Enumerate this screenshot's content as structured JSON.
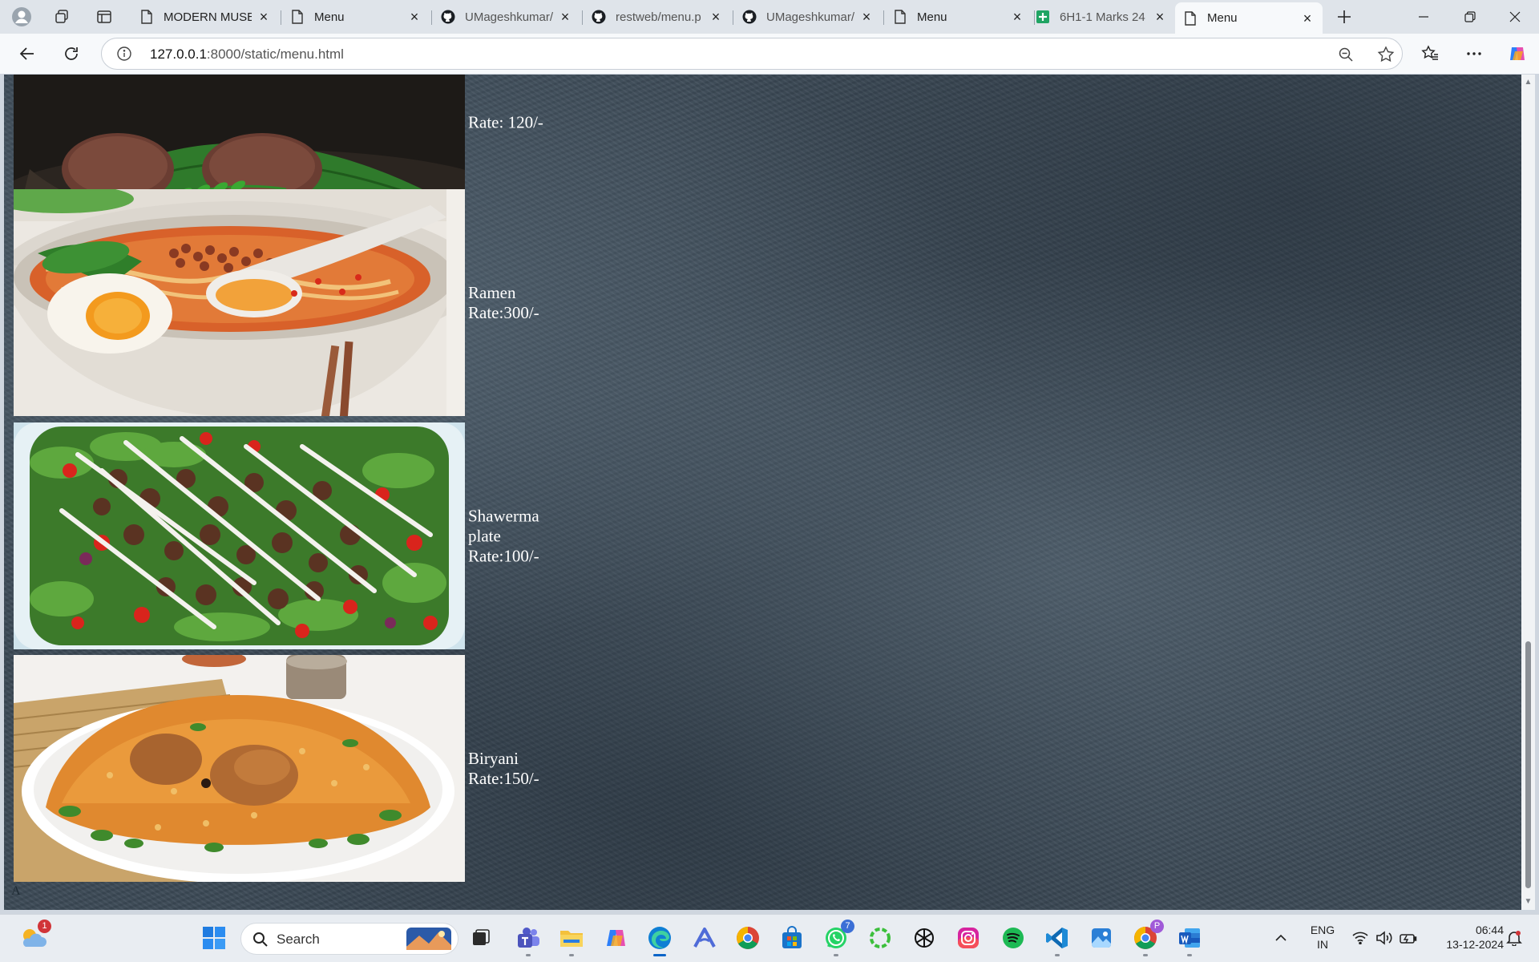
{
  "browser": {
    "tabs": [
      {
        "title": "MODERN MUSE",
        "icon": "page-icon",
        "active": false
      },
      {
        "title": "Menu",
        "icon": "page-icon",
        "active": false
      },
      {
        "title": "UMageshkumar/",
        "icon": "github-icon",
        "active": false
      },
      {
        "title": "restweb/menu.p",
        "icon": "github-icon",
        "active": false
      },
      {
        "title": "UMageshkumar/",
        "icon": "github-icon",
        "active": false
      },
      {
        "title": "Menu",
        "icon": "page-icon",
        "active": false
      },
      {
        "title": "6H1-1 Marks 24",
        "icon": "sheets-icon",
        "active": false
      },
      {
        "title": "Menu",
        "icon": "page-icon",
        "active": true
      }
    ],
    "address": {
      "host": "127.0.0.1",
      "path": ":8000/static/menu.html"
    }
  },
  "page": {
    "items": [
      {
        "name": "",
        "rate": "Rate: 120/-",
        "image": "kebab-patties-on-banana-leaf"
      },
      {
        "name": "Ramen",
        "rate": "Rate:300/-",
        "image": "ramen-bowl-with-egg"
      },
      {
        "name": "Shawerma plate",
        "rate": "Rate:100/-",
        "image": "shawarma-salad-plate"
      },
      {
        "name": "Biryani",
        "rate": "Rate:150/-",
        "image": "chicken-biryani-plate"
      }
    ],
    "corner_text": "A",
    "background_color": "#3c4a56"
  },
  "taskbar": {
    "search_label": "Search",
    "weather_badge": "1",
    "whatsapp_badge": "7",
    "chrome_profile_badge": "P",
    "lang_line1": "ENG",
    "lang_line2": "IN",
    "time": "06:44",
    "date": "13-12-2024"
  }
}
